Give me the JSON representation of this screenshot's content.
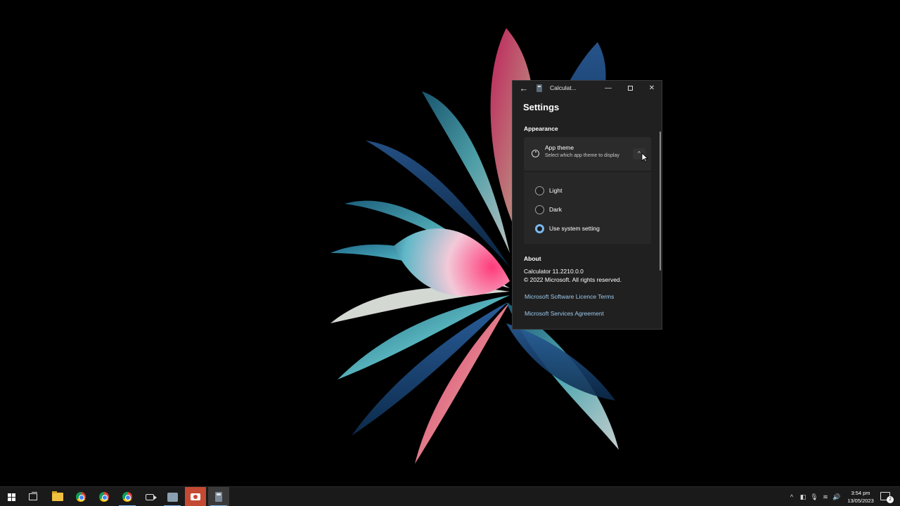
{
  "window": {
    "title": "Calculat...",
    "back_glyph": "←",
    "min_glyph": "—",
    "close_glyph": "✕"
  },
  "settings": {
    "page_title": "Settings",
    "appearance_heading": "Appearance",
    "app_theme_title": "App theme",
    "app_theme_description": "Select which app theme to display",
    "chevron_glyph": "^",
    "theme_options": [
      {
        "label": "Light",
        "selected": false
      },
      {
        "label": "Dark",
        "selected": false
      },
      {
        "label": "Use system setting",
        "selected": true
      }
    ],
    "about_heading": "About",
    "version": "Calculator 11.2210.0.0",
    "copyright": "© 2022 Microsoft. All rights reserved.",
    "link_licence": "Microsoft Software Licence Terms",
    "link_services": "Microsoft Services Agreement"
  },
  "taskbar": {
    "time": "3:54 pm",
    "date": "13/05/2023",
    "notification_count": "2",
    "tray_glyphs": {
      "chevron": "^",
      "mic": "🎙",
      "volume": "🔊",
      "wifi": "≋"
    }
  },
  "colors": {
    "window_bg": "#202020",
    "card_bg": "#2b2b2b",
    "accent": "#7ab8ec",
    "link": "#9cc9ec",
    "taskbar_bg": "#1a1a1a"
  },
  "icons": [
    "back-arrow-icon",
    "calculator-icon",
    "minimize-icon",
    "maximize-icon",
    "close-icon",
    "palette-icon",
    "chevron-up-icon",
    "windows-icon",
    "task-view-icon",
    "file-explorer-icon",
    "chrome-icon",
    "camera-icon",
    "notification-icon"
  ]
}
